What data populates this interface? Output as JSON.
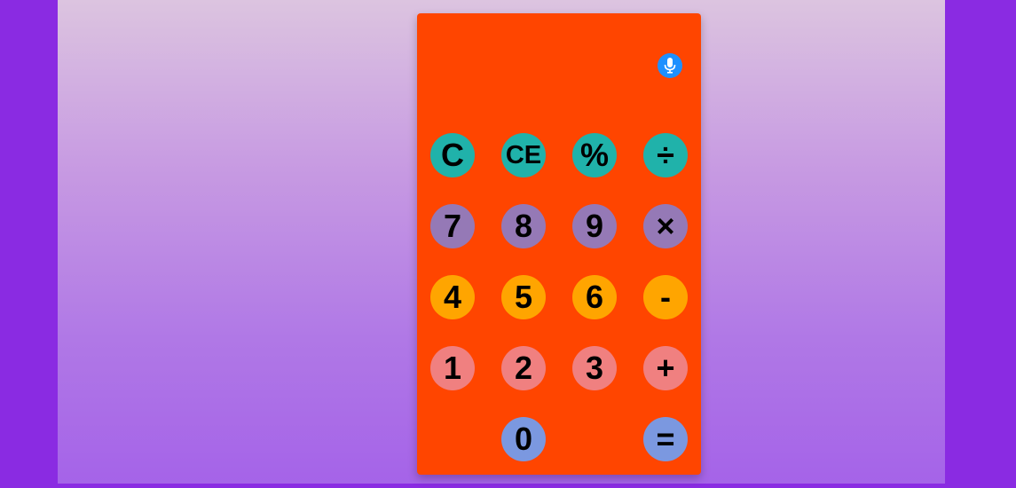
{
  "display": {
    "value": ""
  },
  "mic": {
    "icon": "microphone-icon",
    "color": "#1e90ff"
  },
  "colors": {
    "outer_background": "#8a2be2",
    "calculator_body": "#ff4500",
    "row_function": "#20b2aa",
    "row_789": "#9579b6",
    "row_456": "#ffa500",
    "row_123": "#f08080",
    "row_0": "#7b98e0"
  },
  "keys": {
    "clear": "C",
    "clear_entry": "CE",
    "percent": "%",
    "divide": "÷",
    "seven": "7",
    "eight": "8",
    "nine": "9",
    "multiply": "×",
    "four": "4",
    "five": "5",
    "six": "6",
    "subtract": "-",
    "one": "1",
    "two": "2",
    "three": "3",
    "add": "+",
    "zero": "0",
    "equals": "="
  }
}
